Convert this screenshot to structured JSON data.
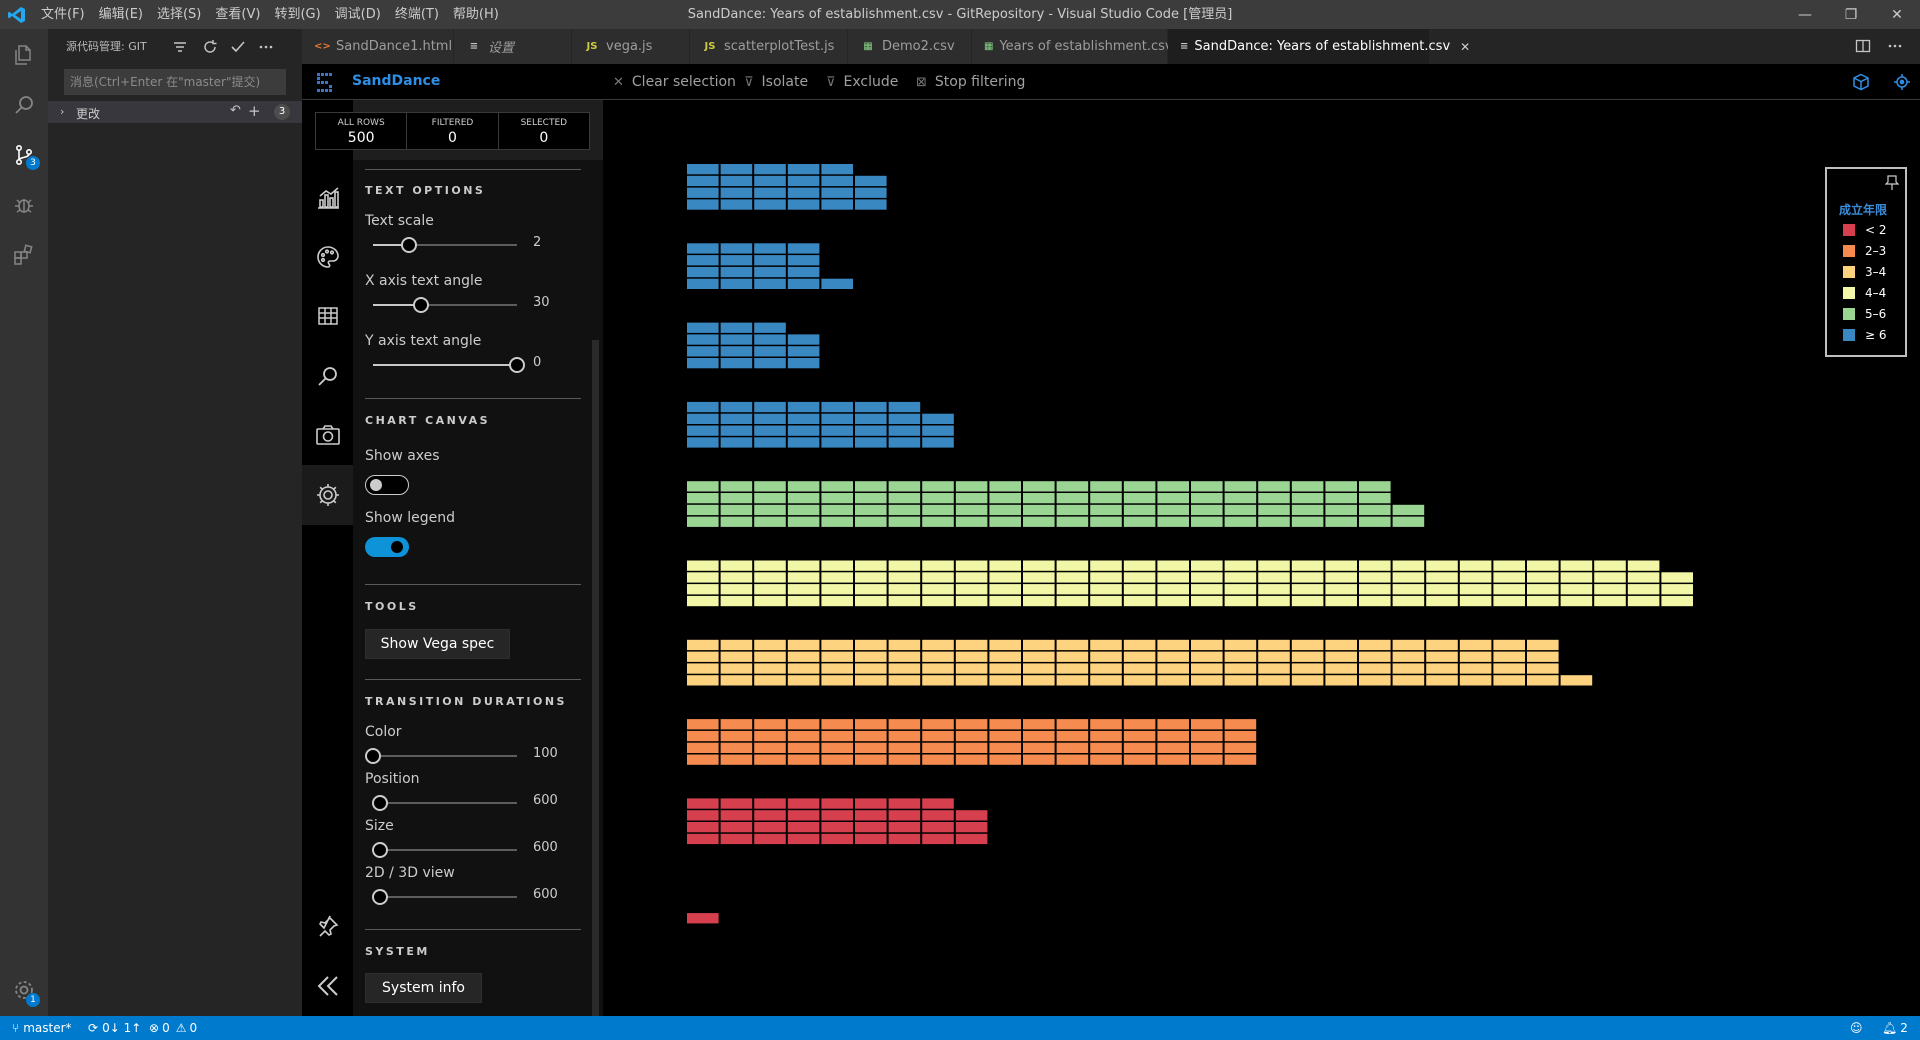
{
  "window": {
    "title": "SandDance: Years of establishment.csv - GitRepository - Visual Studio Code [管理员]",
    "menu": [
      "文件(F)",
      "编辑(E)",
      "选择(S)",
      "查看(V)",
      "转到(G)",
      "调试(D)",
      "终端(T)",
      "帮助(H)"
    ]
  },
  "activity_bar": {
    "items": [
      "files-icon",
      "search-icon",
      "source-control-icon",
      "debug-icon",
      "extensions-icon"
    ],
    "scm_badge": "3",
    "settings_badge": "1"
  },
  "sidebar": {
    "header": "源代码管理: GIT",
    "commit_placeholder": "消息(Ctrl+Enter 在\"master\"提交)",
    "changes_label": "更改",
    "changes_count": "3"
  },
  "tabs": [
    {
      "icon": "<>",
      "label": "SandDance1.html",
      "color": "#e37933"
    },
    {
      "icon": "≡",
      "label": "设置",
      "color": "#c5c5c5"
    },
    {
      "icon": "JS",
      "label": "vega.js",
      "color": "#cbcb41"
    },
    {
      "icon": "JS",
      "label": "scatterplotTest.js",
      "color": "#cbcb41"
    },
    {
      "icon": "▦",
      "label": "Demo2.csv",
      "color": "#89d185"
    },
    {
      "icon": "▦",
      "label": "Years of establishment.csv",
      "color": "#89d185"
    },
    {
      "icon": "≡",
      "label": "SandDance: Years of establishment.csv",
      "color": "#c5c5c5",
      "close": "✕"
    }
  ],
  "sanddance": {
    "brand": "SandDance",
    "toolbar": [
      "Clear selection",
      "Isolate",
      "Exclude",
      "Stop filtering"
    ],
    "counts": [
      {
        "label": "ALL ROWS",
        "value": "500"
      },
      {
        "label": "FILTERED",
        "value": "0"
      },
      {
        "label": "SELECTED",
        "value": "0"
      }
    ],
    "panel_tabs": [
      "chart-icon",
      "palette-icon",
      "table-icon",
      "search-icon",
      "camera-icon",
      "gear-icon"
    ],
    "text_options": {
      "title": "TEXT OPTIONS",
      "sliders": [
        {
          "label": "Text scale",
          "value": "2",
          "fraction": 0.25
        },
        {
          "label": "X axis text angle",
          "value": "30",
          "fraction": 0.33
        },
        {
          "label": "Y axis text angle",
          "value": "0",
          "fraction": 1.0
        }
      ]
    },
    "chart_canvas": {
      "title": "CHART CANVAS",
      "show_axes_label": "Show axes",
      "show_axes": false,
      "show_legend_label": "Show legend",
      "show_legend": true
    },
    "tools": {
      "title": "TOOLS",
      "button": "Show Vega spec"
    },
    "transitions": {
      "title": "TRANSITION DURATIONS",
      "sliders": [
        {
          "label": "Color",
          "value": "100",
          "fraction": 0.0
        },
        {
          "label": "Position",
          "value": "600",
          "fraction": 0.05
        },
        {
          "label": "Size",
          "value": "600",
          "fraction": 0.05
        },
        {
          "label": "2D / 3D view",
          "value": "600",
          "fraction": 0.05
        }
      ]
    },
    "system": {
      "title": "SYSTEM",
      "button": "System info"
    }
  },
  "chart_data": {
    "type": "bar",
    "legend_title": "成立年限",
    "legend_position": "top-right",
    "legend": [
      {
        "label": "< 2",
        "color": "#d6404e"
      },
      {
        "label": "2–3",
        "color": "#f58b4f"
      },
      {
        "label": "3–4",
        "color": "#fdd380"
      },
      {
        "label": "4–4",
        "color": "#f1f7a6"
      },
      {
        "label": "5–6",
        "color": "#9bd593"
      },
      {
        "label": "≥ 6",
        "color": "#3a88c2"
      }
    ],
    "rows": [
      {
        "color": "#3a88c2",
        "count": 23
      },
      {
        "color": "#3a88c2",
        "count": 17
      },
      {
        "color": "#3a88c2",
        "count": 15
      },
      {
        "color": "#3a88c2",
        "count": 31
      },
      {
        "color": "#9bd593",
        "count": 86
      },
      {
        "color": "#f1f7a6",
        "count": 119
      },
      {
        "color": "#fdd380",
        "count": 105
      },
      {
        "color": "#f58b4f",
        "count": 68
      },
      {
        "color": "#d6404e",
        "count": 35
      },
      {
        "color": "#d6404e",
        "count": 1
      }
    ],
    "grid": false
  },
  "status": {
    "branch": "master*",
    "sync": "0↓ 1↑",
    "errors": "0",
    "warnings": "0",
    "notifications": "2"
  }
}
